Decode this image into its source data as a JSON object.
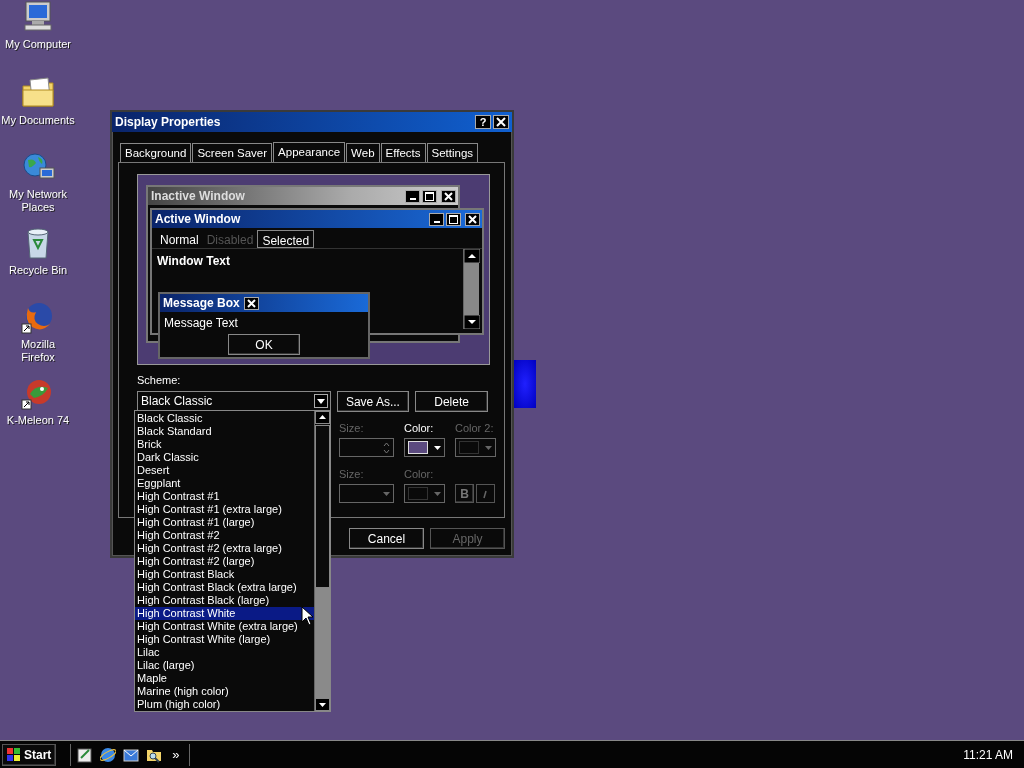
{
  "desktop_icons": [
    {
      "label": "My Computer",
      "kind": "computer"
    },
    {
      "label": "My Documents",
      "kind": "folder"
    },
    {
      "label": "My Network Places",
      "kind": "network"
    },
    {
      "label": "Recycle Bin",
      "kind": "bin"
    },
    {
      "label": "Mozilla Firefox",
      "kind": "firefox"
    },
    {
      "label": "K-Meleon 74",
      "kind": "meleon"
    }
  ],
  "dialog": {
    "title": "Display Properties",
    "help": "?",
    "tabs": [
      {
        "label": "Background",
        "selected": false
      },
      {
        "label": "Screen Saver",
        "selected": false
      },
      {
        "label": "Appearance",
        "selected": true
      },
      {
        "label": "Web",
        "selected": false
      },
      {
        "label": "Effects",
        "selected": false
      },
      {
        "label": "Settings",
        "selected": false
      }
    ],
    "preview": {
      "inactive_title": "Inactive Window",
      "active_title": "Active Window",
      "menu": [
        {
          "label": "Normal",
          "disabled": false,
          "selected": false
        },
        {
          "label": "Disabled",
          "disabled": true,
          "selected": false
        },
        {
          "label": "Selected",
          "disabled": false,
          "selected": true
        }
      ],
      "window_text": "Window Text",
      "message_title": "Message Box",
      "message_text": "Message Text",
      "ok": "OK"
    },
    "scheme_label": "Scheme:",
    "scheme_value": "Black Classic",
    "scheme_buttons": [
      "Save As...",
      "Delete"
    ],
    "item_row": [
      {
        "label": "Size:",
        "disabled": true,
        "kind": "spin"
      },
      {
        "label": "Color:",
        "disabled": false,
        "kind": "color"
      },
      {
        "label": "Color 2:",
        "disabled": true,
        "kind": "color"
      }
    ],
    "font_row": [
      {
        "label": "Size:",
        "disabled": true,
        "kind": "combo"
      },
      {
        "label": "Color:",
        "disabled": true,
        "kind": "color"
      }
    ],
    "bold": "B",
    "footer_buttons": [
      {
        "label": "Cancel",
        "disabled": false
      },
      {
        "label": "Apply",
        "disabled": true
      }
    ],
    "dropdown": [
      {
        "label": "Black Classic",
        "selected": false
      },
      {
        "label": "Black Standard",
        "selected": false
      },
      {
        "label": "Brick",
        "selected": false
      },
      {
        "label": "Dark Classic",
        "selected": false
      },
      {
        "label": "Desert",
        "selected": false
      },
      {
        "label": "Eggplant",
        "selected": false
      },
      {
        "label": "High Contrast #1",
        "selected": false
      },
      {
        "label": "High Contrast #1 (extra large)",
        "selected": false
      },
      {
        "label": "High Contrast #1 (large)",
        "selected": false
      },
      {
        "label": "High Contrast #2",
        "selected": false
      },
      {
        "label": "High Contrast #2 (extra large)",
        "selected": false
      },
      {
        "label": "High Contrast #2 (large)",
        "selected": false
      },
      {
        "label": "High Contrast Black",
        "selected": false
      },
      {
        "label": "High Contrast Black (extra large)",
        "selected": false
      },
      {
        "label": "High Contrast Black (large)",
        "selected": false
      },
      {
        "label": "High Contrast White",
        "selected": true
      },
      {
        "label": "High Contrast White (extra large)",
        "selected": false
      },
      {
        "label": "High Contrast White (large)",
        "selected": false
      },
      {
        "label": "Lilac",
        "selected": false
      },
      {
        "label": "Lilac (large)",
        "selected": false
      },
      {
        "label": "Maple",
        "selected": false
      },
      {
        "label": "Marine (high color)",
        "selected": false
      },
      {
        "label": "Plum (high color)",
        "selected": false
      }
    ]
  },
  "taskbar": {
    "start": "Start",
    "more": "»",
    "clock": "11:21 AM"
  }
}
